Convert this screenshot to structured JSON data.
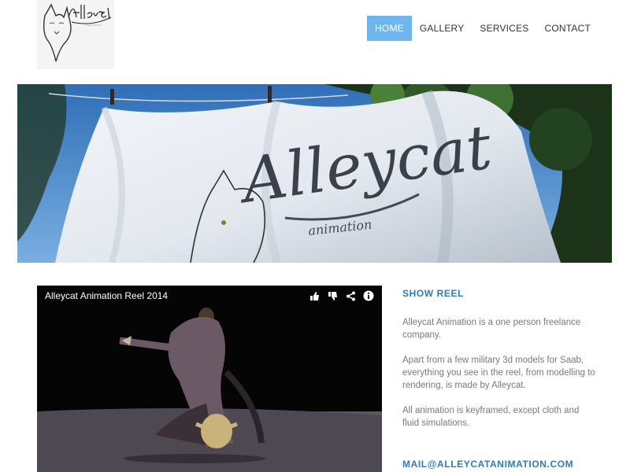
{
  "header": {
    "nav": [
      {
        "label": "HOME",
        "active": true
      },
      {
        "label": "GALLERY",
        "active": false
      },
      {
        "label": "SERVICES",
        "active": false
      },
      {
        "label": "CONTACT",
        "active": false
      }
    ]
  },
  "video": {
    "title": "Alleycat Animation Reel 2014",
    "icons": [
      "thumbs-up-icon",
      "thumbs-down-icon",
      "share-icon",
      "info-icon"
    ]
  },
  "side": {
    "heading": "SHOW REEL",
    "paragraphs": [
      "Alleycat Animation is a one person freelance company.",
      "Apart from a few military 3d models for Saab, everything you see in the reel, from modelling to rendering, is made by Alleycat.",
      "All animation is keyframed, except cloth and fluid simulations."
    ],
    "email": "MAIL@ALLEYCATANIMATION.COM"
  },
  "colors": {
    "accent": "#2e7bbf",
    "nav_active": "#6fb6ee"
  }
}
